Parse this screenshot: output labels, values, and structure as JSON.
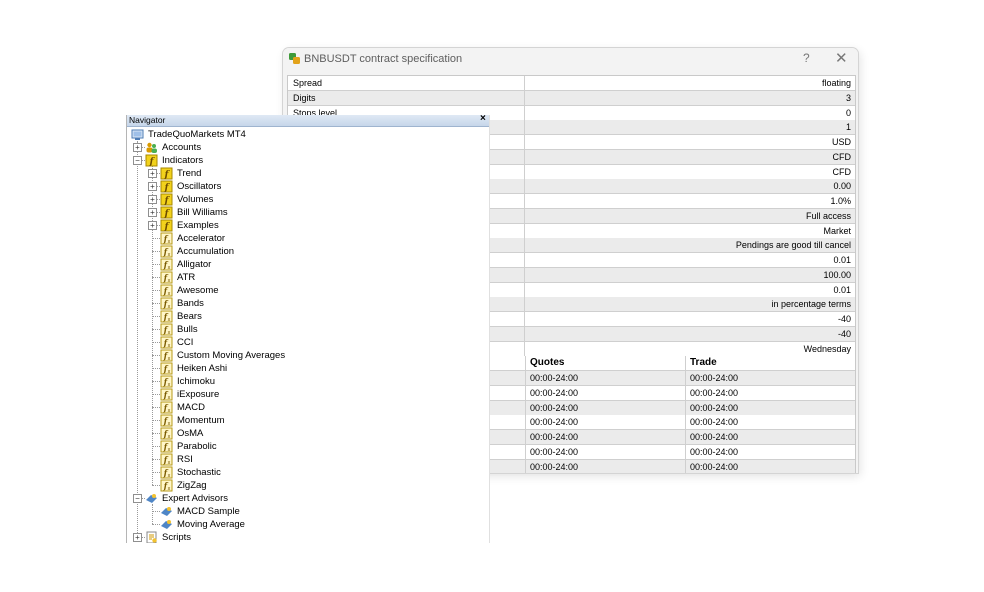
{
  "spec_window": {
    "title": "BNBUSDT contract specification",
    "help_label": "?",
    "close_label": "✕",
    "rows": [
      {
        "label": "Spread",
        "value": "floating"
      },
      {
        "label": "Digits",
        "value": "3"
      },
      {
        "label": "Stops level",
        "value": "0"
      },
      {
        "label": "",
        "value": "1"
      },
      {
        "label": "",
        "value": "USD"
      },
      {
        "label": "",
        "value": "CFD"
      },
      {
        "label": "",
        "value": "CFD"
      },
      {
        "label": "",
        "value": "0.00"
      },
      {
        "label": "",
        "value": "1.0%"
      },
      {
        "label": "",
        "value": "Full access"
      },
      {
        "label": "",
        "value": "Market"
      },
      {
        "label": "",
        "value": "Pendings are good till cancel"
      },
      {
        "label": "",
        "value": "0.01"
      },
      {
        "label": "",
        "value": "100.00"
      },
      {
        "label": "",
        "value": "0.01"
      },
      {
        "label": "",
        "value": "in percentage terms"
      },
      {
        "label": "",
        "value": "-40"
      },
      {
        "label": "",
        "value": "-40"
      },
      {
        "label": "",
        "value": "Wednesday"
      }
    ],
    "sessions": {
      "header_quotes": "Quotes",
      "header_trade": "Trade",
      "rows": [
        {
          "quotes": "00:00-24:00",
          "trade": "00:00-24:00"
        },
        {
          "quotes": "00:00-24:00",
          "trade": "00:00-24:00"
        },
        {
          "quotes": "00:00-24:00",
          "trade": "00:00-24:00"
        },
        {
          "quotes": "00:00-24:00",
          "trade": "00:00-24:00"
        },
        {
          "quotes": "00:00-24:00",
          "trade": "00:00-24:00"
        },
        {
          "quotes": "00:00-24:00",
          "trade": "00:00-24:00"
        },
        {
          "quotes": "00:00-24:00",
          "trade": "00:00-24:00"
        }
      ]
    }
  },
  "navigator": {
    "title": "Navigator",
    "close_label": "×",
    "root": "TradeQuoMarkets MT4",
    "accounts": "Accounts",
    "indicators": "Indicators",
    "indicator_folders": [
      "Trend",
      "Oscillators",
      "Volumes",
      "Bill Williams",
      "Examples"
    ],
    "indicator_items": [
      "Accelerator",
      "Accumulation",
      "Alligator",
      "ATR",
      "Awesome",
      "Bands",
      "Bears",
      "Bulls",
      "CCI",
      "Custom Moving Averages",
      "Heiken Ashi",
      "Ichimoku",
      "iExposure",
      "MACD",
      "Momentum",
      "OsMA",
      "Parabolic",
      "RSI",
      "Stochastic",
      "ZigZag"
    ],
    "expert_advisors": "Expert Advisors",
    "ea_items": [
      "MACD Sample",
      "Moving Average"
    ],
    "scripts": "Scripts"
  },
  "colors": {
    "folder_yellow": "#f2d21c",
    "indicator_icon": "#e8c22a",
    "accounts_icon": "#d99a00",
    "ea_icon": "#4f86c6",
    "nav_title_bg": "#c6d6ea"
  },
  "icons": {
    "app": "mt4-app-icon",
    "root": "terminal-icon",
    "folder": "indicator-folder-icon",
    "indicator": "indicator-icon",
    "expert": "expert-advisor-icon",
    "scripts": "scripts-icon"
  }
}
